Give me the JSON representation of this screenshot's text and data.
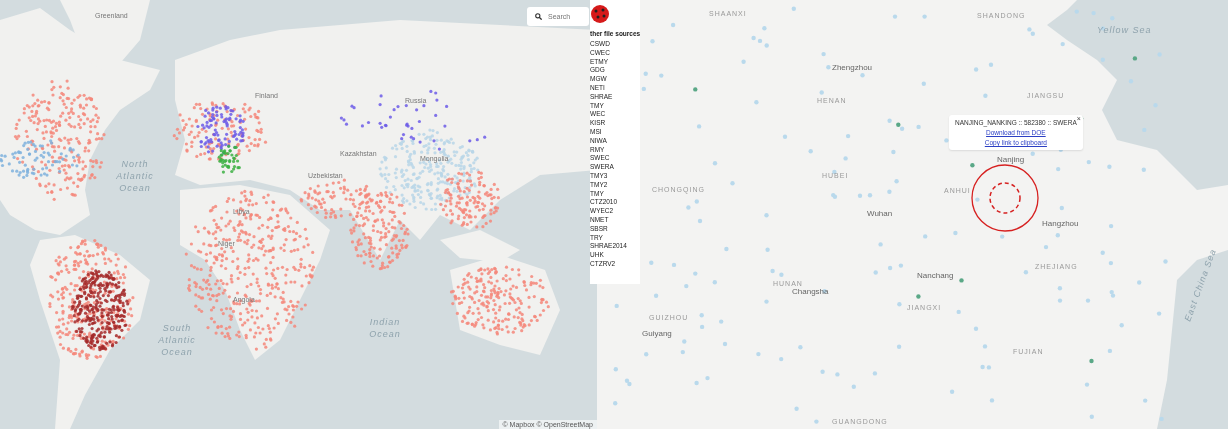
{
  "world_map": {
    "search": {
      "placeholder": "Search"
    },
    "labels": [
      {
        "text": "Greenland",
        "kind": "country"
      },
      {
        "text": "Finland",
        "kind": "country"
      },
      {
        "text": "Russia",
        "kind": "country"
      },
      {
        "text": "North Atlantic Ocean",
        "kind": "ocean"
      },
      {
        "text": "Kazakhstan",
        "kind": "country"
      },
      {
        "text": "Mongolia",
        "kind": "country"
      },
      {
        "text": "Uzbekistan",
        "kind": "country"
      },
      {
        "text": "Libya",
        "kind": "country"
      },
      {
        "text": "Niger",
        "kind": "country"
      },
      {
        "text": "Angola",
        "kind": "country"
      },
      {
        "text": "South Atlantic Ocean",
        "kind": "ocean"
      },
      {
        "text": "Indian Ocean",
        "kind": "ocean"
      }
    ],
    "attribution": "© Mapbox © OpenStreetMap"
  },
  "region_map": {
    "labels": [
      {
        "text": "SHAANXI",
        "kind": "province"
      },
      {
        "text": "SHANDONG",
        "kind": "province"
      },
      {
        "text": "Yellow Sea",
        "kind": "ocean"
      },
      {
        "text": "Zhengzhou",
        "kind": "city"
      },
      {
        "text": "HENAN",
        "kind": "province"
      },
      {
        "text": "JIANGSU",
        "kind": "province"
      },
      {
        "text": "Nanjing",
        "kind": "city"
      },
      {
        "text": "HUBEI",
        "kind": "province"
      },
      {
        "text": "ANHUI",
        "kind": "province"
      },
      {
        "text": "CHONGQING",
        "kind": "province"
      },
      {
        "text": "Wuhan",
        "kind": "city"
      },
      {
        "text": "Hangzhou",
        "kind": "city"
      },
      {
        "text": "ZHEJIANG",
        "kind": "province"
      },
      {
        "text": "East China Sea",
        "kind": "ocean"
      },
      {
        "text": "Nanchang",
        "kind": "city"
      },
      {
        "text": "HUNAN",
        "kind": "province"
      },
      {
        "text": "Changsha",
        "kind": "city"
      },
      {
        "text": "JIANGXI",
        "kind": "province"
      },
      {
        "text": "GUIZHOU",
        "kind": "province"
      },
      {
        "text": "Guiyang",
        "kind": "city"
      },
      {
        "text": "FUJIAN",
        "kind": "province"
      },
      {
        "text": "GUANGDONG",
        "kind": "province"
      }
    ],
    "legend": {
      "title": "ther file sources",
      "items": [
        "CSWD",
        "CWEC",
        "ETMY",
        "GDG",
        "MGW",
        "NETI",
        "SHRAE",
        "TMY",
        "WEC",
        "KISR",
        "MSI",
        "NIWA",
        "RMY",
        "SWEC",
        "SWERA",
        "TMY3",
        "TMY2",
        "TMY",
        "CTZ2010",
        "WYEC2",
        "NMET",
        "SBSR",
        "TRY",
        "SHRAE2014",
        "UHK",
        "CTZRV2"
      ]
    },
    "popup": {
      "title": "NANJING_NANKING :: 582380 :: SWERA",
      "links": [
        "Download from DOE",
        "Copy link to clipboard"
      ],
      "close": "×"
    }
  }
}
